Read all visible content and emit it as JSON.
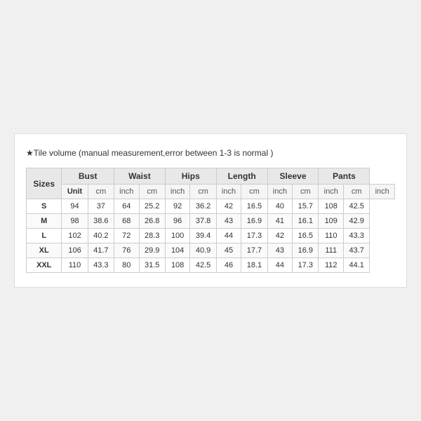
{
  "note": "★Tile volume (manual measurement,error between 1-3 is normal )",
  "table": {
    "headers": [
      "Sizes",
      "Bust",
      "",
      "Waist",
      "",
      "Hips",
      "",
      "Length",
      "",
      "Sleeve",
      "",
      "Pants",
      ""
    ],
    "unit_row": [
      "Unit",
      "cm",
      "inch",
      "cm",
      "inch",
      "cm",
      "inch",
      "cm",
      "inch",
      "cm",
      "inch",
      "cm",
      "inch"
    ],
    "rows": [
      {
        "size": "S",
        "bust_cm": "94",
        "bust_in": "37",
        "waist_cm": "64",
        "waist_in": "25.2",
        "hips_cm": "92",
        "hips_in": "36.2",
        "len_cm": "42",
        "len_in": "16.5",
        "slv_cm": "40",
        "slv_in": "15.7",
        "pant_cm": "108",
        "pant_in": "42.5"
      },
      {
        "size": "M",
        "bust_cm": "98",
        "bust_in": "38.6",
        "waist_cm": "68",
        "waist_in": "26.8",
        "hips_cm": "96",
        "hips_in": "37.8",
        "len_cm": "43",
        "len_in": "16.9",
        "slv_cm": "41",
        "slv_in": "16.1",
        "pant_cm": "109",
        "pant_in": "42.9"
      },
      {
        "size": "L",
        "bust_cm": "102",
        "bust_in": "40.2",
        "waist_cm": "72",
        "waist_in": "28.3",
        "hips_cm": "100",
        "hips_in": "39.4",
        "len_cm": "44",
        "len_in": "17.3",
        "slv_cm": "42",
        "slv_in": "16.5",
        "pant_cm": "110",
        "pant_in": "43.3"
      },
      {
        "size": "XL",
        "bust_cm": "106",
        "bust_in": "41.7",
        "waist_cm": "76",
        "waist_in": "29.9",
        "hips_cm": "104",
        "hips_in": "40.9",
        "len_cm": "45",
        "len_in": "17.7",
        "slv_cm": "43",
        "slv_in": "16.9",
        "pant_cm": "111",
        "pant_in": "43.7"
      },
      {
        "size": "XXL",
        "bust_cm": "110",
        "bust_in": "43.3",
        "waist_cm": "80",
        "waist_in": "31.5",
        "hips_cm": "108",
        "hips_in": "42.5",
        "len_cm": "46",
        "len_in": "18.1",
        "slv_cm": "44",
        "slv_in": "17.3",
        "pant_cm": "112",
        "pant_in": "44.1"
      }
    ]
  }
}
